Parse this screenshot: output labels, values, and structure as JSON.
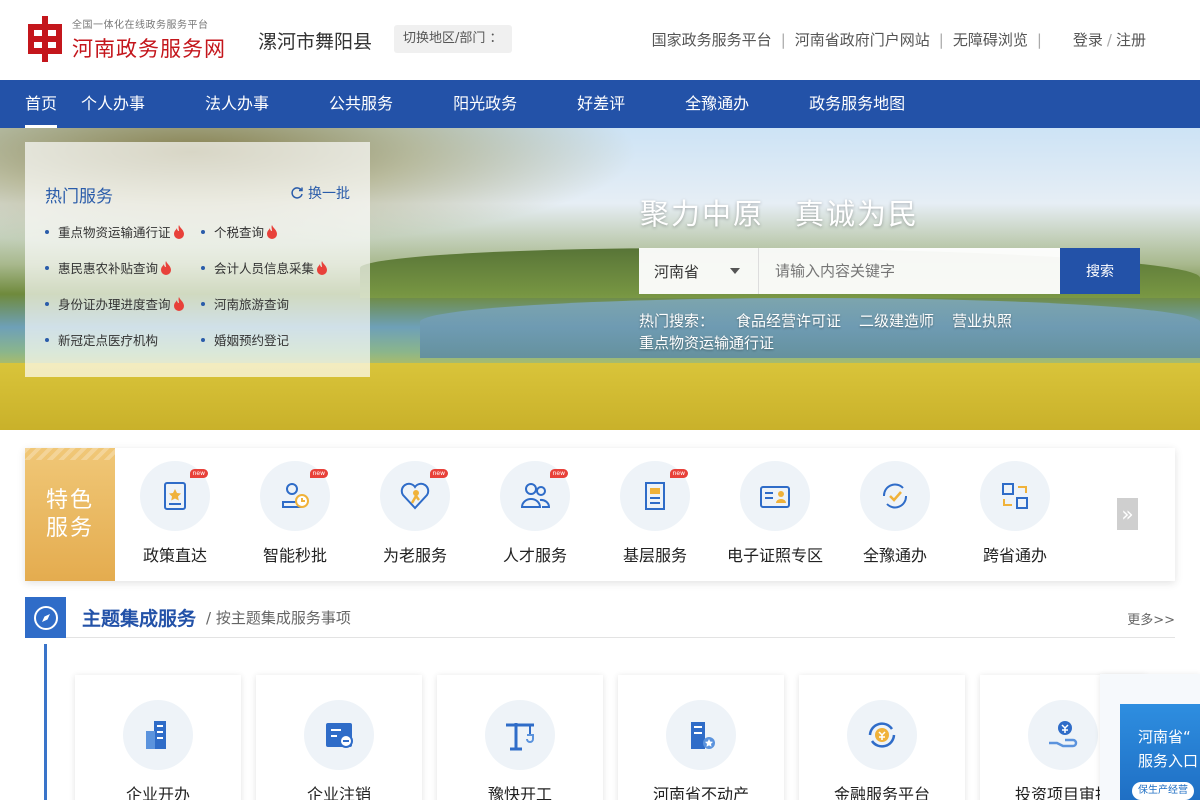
{
  "header": {
    "logo_small": "全国一体化在线政务服务平台",
    "logo_big": "河南政务服务网",
    "region": "漯河市舞阳县",
    "switch_label": "切换地区/部门 ：",
    "links": [
      "国家政务服务平台",
      "河南省政府门户网站",
      "无障碍浏览"
    ],
    "login": "登录",
    "register": "注册"
  },
  "nav": {
    "items": [
      "首页",
      "个人办事",
      "法人办事",
      "公共服务",
      "阳光政务",
      "好差评",
      "全豫通办",
      "政务服务地图"
    ]
  },
  "hero": {
    "hot_title": "热门服务",
    "refresh": "换一批",
    "hot_items": [
      {
        "label": "重点物资运输通行证",
        "hot": true
      },
      {
        "label": "个税查询",
        "hot": true
      },
      {
        "label": "惠民惠农补贴查询",
        "hot": true
      },
      {
        "label": "会计人员信息采集",
        "hot": true
      },
      {
        "label": "身份证办理进度查询",
        "hot": true
      },
      {
        "label": "河南旅游查询",
        "hot": false
      },
      {
        "label": "新冠定点医疗机构",
        "hot": false
      },
      {
        "label": "婚姻预约登记",
        "hot": false
      }
    ],
    "slogan": "聚力中原　真诚为民",
    "search_scope": "河南省",
    "search_placeholder": "请输入内容关键字",
    "search_button": "搜索",
    "hot_search_label": "热门搜索：",
    "hot_search_keywords": [
      "食品经营许可证",
      "二级建造师",
      "营业执照",
      "重点物资运输通行证"
    ]
  },
  "feature": {
    "label_line1": "特色",
    "label_line2": "服务",
    "items": [
      {
        "label": "政策直达",
        "icon": "policy-icon",
        "new": true,
        "new_text": "new"
      },
      {
        "label": "智能秒批",
        "icon": "smart-approval-icon",
        "new": true,
        "new_text": "new"
      },
      {
        "label": "为老服务",
        "icon": "elderly-care-icon",
        "new": true,
        "new_text": "new"
      },
      {
        "label": "人才服务",
        "icon": "talent-icon",
        "new": true,
        "new_text": "new"
      },
      {
        "label": "基层服务",
        "icon": "grassroots-icon",
        "new": true,
        "new_text": "new"
      },
      {
        "label": "电子证照专区",
        "icon": "e-license-icon",
        "new": false
      },
      {
        "label": "全豫通办",
        "icon": "province-wide-icon",
        "new": false
      },
      {
        "label": "跨省通办",
        "icon": "cross-province-icon",
        "new": false
      }
    ],
    "next": "»"
  },
  "theme": {
    "title": "主题集成服务",
    "subtitle": "/ 按主题集成服务事项",
    "more": "更多>>",
    "cards": [
      {
        "label": "企业开办",
        "icon": "building-icon"
      },
      {
        "label": "企业注销",
        "icon": "cancel-icon"
      },
      {
        "label": "豫快开工",
        "icon": "crane-icon"
      },
      {
        "label": "河南省不动产",
        "icon": "real-estate-icon"
      },
      {
        "label": "金融服务平台",
        "icon": "finance-icon"
      },
      {
        "label": "投资项目审批",
        "icon": "investment-icon"
      }
    ]
  },
  "float_ad": {
    "line1": "河南省“",
    "line2": "服务入口",
    "tag": "保生产经营"
  },
  "colors": {
    "brand_red": "#c4161c",
    "nav_blue": "#2352a8",
    "feature_gold": "#e4ac4f"
  }
}
